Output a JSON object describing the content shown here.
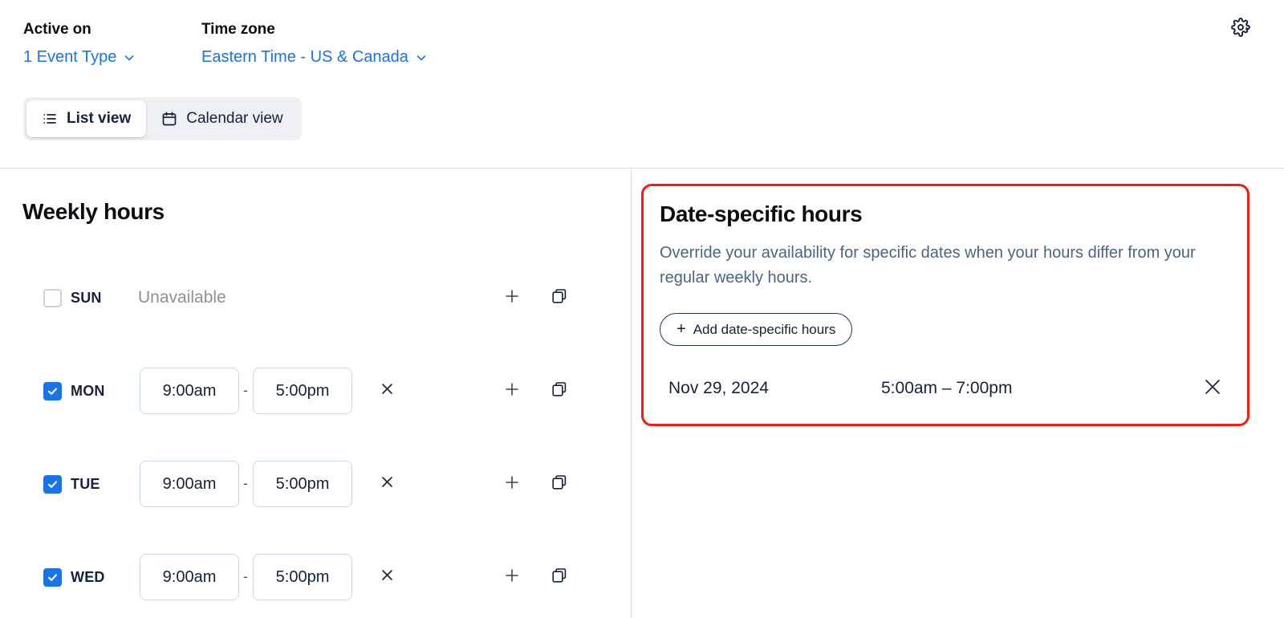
{
  "header": {
    "active_on": {
      "label": "Active on",
      "value": "1 Event Type",
      "chevron_icon": "chevron-down-icon"
    },
    "time_zone": {
      "label": "Time zone",
      "value": "Eastern Time - US & Canada",
      "chevron_icon": "chevron-down-icon"
    },
    "settings_icon": "gear-icon"
  },
  "view_toggle": {
    "options": [
      {
        "label": "List view",
        "icon": "list-icon",
        "active": true
      },
      {
        "label": "Calendar view",
        "icon": "calendar-icon",
        "active": false
      }
    ]
  },
  "weekly_hours": {
    "title": "Weekly hours",
    "unavailable_text": "Unavailable",
    "range_separator": "-",
    "row_icons": {
      "remove_icon": "close-x-icon",
      "add_icon": "plus-icon",
      "duplicate_icon": "copy-icon"
    },
    "days": [
      {
        "day": "SUN",
        "checked": false,
        "available": false,
        "start": "",
        "end": ""
      },
      {
        "day": "MON",
        "checked": true,
        "available": true,
        "start": "9:00am",
        "end": "5:00pm"
      },
      {
        "day": "TUE",
        "checked": true,
        "available": true,
        "start": "9:00am",
        "end": "5:00pm"
      },
      {
        "day": "WED",
        "checked": true,
        "available": true,
        "start": "9:00am",
        "end": "5:00pm"
      }
    ]
  },
  "date_specific": {
    "title": "Date-specific hours",
    "description": "Override your availability for specific dates when your hours differ from your regular weekly hours.",
    "add_button": {
      "label": "Add date-specific hours",
      "plus": "+",
      "icon": "plus-icon"
    },
    "entries": [
      {
        "date": "Nov 29, 2024",
        "time_range": "5:00am – 7:00pm",
        "remove_icon": "close-x-icon"
      }
    ]
  },
  "annotation": {
    "highlight_color": "#f71b0e"
  },
  "colors": {
    "link": "#1a73e8",
    "checkbox_checked": "#1a73e8",
    "text_primary": "#0b0e14",
    "text_muted": "#8b9099",
    "description": "#4a6583"
  }
}
